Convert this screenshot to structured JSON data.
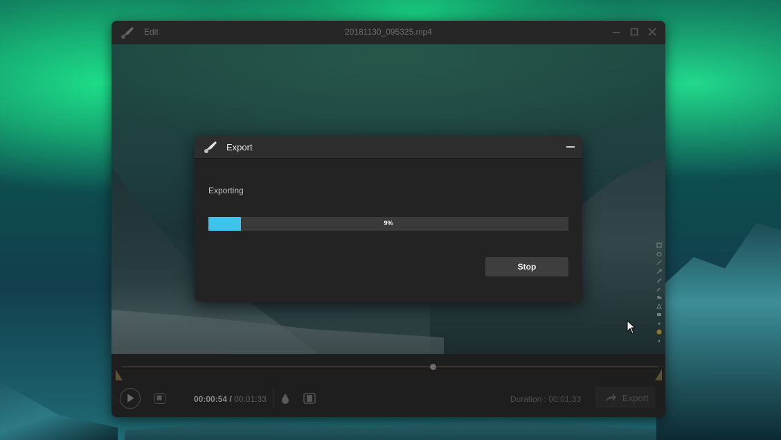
{
  "app": {
    "menu_edit": "Edit",
    "title": "20181130_095325.mp4"
  },
  "timeline": {
    "current_time": "00:00:54",
    "separator": " / ",
    "total_time": "00:01:33",
    "duration_label": "Duration : 00:01:33",
    "export_label": "Export",
    "playhead_fraction": 0.58
  },
  "dialog": {
    "title": "Export",
    "status": "Exporting",
    "progress_fraction": 0.09,
    "progress_text": "9%",
    "stop_label": "Stop"
  },
  "colors": {
    "progress_fill": "#3fc3ea",
    "dialog_bg": "#232323",
    "timeline_marker": "#5a5230"
  }
}
